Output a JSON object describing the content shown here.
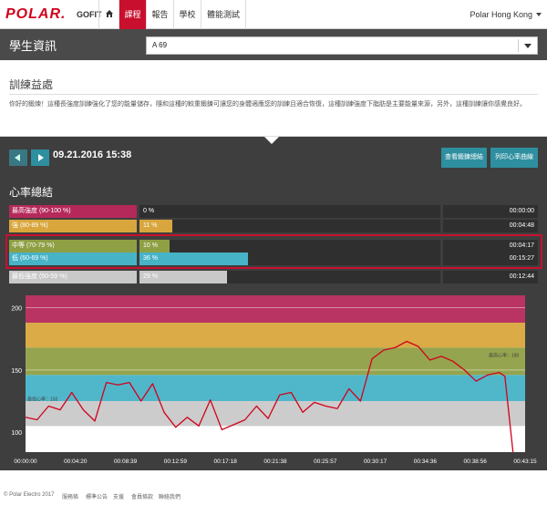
{
  "header": {
    "logo": "POLAR.",
    "product": "GOFIT",
    "nav": [
      "課程",
      "報告",
      "學校",
      "體能測試"
    ],
    "active_nav": "課程",
    "user": "Polar Hong Kong"
  },
  "student": {
    "label": "學生資訊",
    "selected": "A 69"
  },
  "benefit": {
    "title": "訓練益處",
    "text": "你好的鍛煉！這種長強度訓練強化了您的能量儲存，隨和這種的較重鍛鍊可讓您的身體適應您的訓練且適合恢復，這種訓練強度下脂肪是主要能量來源，另外，這種訓練讓你感覺良好。"
  },
  "session": {
    "date": "09.21.2016 15:38",
    "btn_detail": "查看鍛鍊總結",
    "btn_hr": "列印心率曲線",
    "hr_title": "心率總結"
  },
  "zones": [
    {
      "name": "最高強度 (90-100 %)",
      "pct_label": "0 %",
      "pct": 0,
      "time": "00:00:00",
      "color": "#b5295a",
      "name_bg": "#b5295a"
    },
    {
      "name": "強 (80-89 %)",
      "pct_label": "11 %",
      "pct": 11,
      "time": "00:04:48",
      "color": "#d8a63c",
      "name_bg": "#d8a63c"
    },
    {
      "name": "中等 (70-79 %)",
      "pct_label": "10 %",
      "pct": 10,
      "time": "00:04:17",
      "color": "#8f9f44",
      "name_bg": "#8f9f44"
    },
    {
      "name": "低 (60-69 %)",
      "pct_label": "36 %",
      "pct": 36,
      "time": "00:15:27",
      "color": "#47b3c7",
      "name_bg": "#47b3c7"
    },
    {
      "name": "最低強度 (50-59 %)",
      "pct_label": "29 %",
      "pct": 29,
      "time": "00:12:44",
      "color": "#c9c9c9",
      "name_bg": "#c9c9c9"
    }
  ],
  "chart_data": {
    "type": "line",
    "ylim": [
      0,
      210
    ],
    "yticks": [
      0,
      100,
      150,
      200
    ],
    "xticks": [
      "00:00:00",
      "00:04:20",
      "00:08:39",
      "00:12:59",
      "00:17:18",
      "00:21:38",
      "00:25:57",
      "00:30:17",
      "00:34:36",
      "00:38:56",
      "00:43:15"
    ],
    "zone_bands": [
      {
        "from": 188,
        "to": 210,
        "color": "#b5295a"
      },
      {
        "from": 168,
        "to": 188,
        "color": "#d8a63c"
      },
      {
        "from": 146,
        "to": 168,
        "color": "#8f9f44"
      },
      {
        "from": 125,
        "to": 146,
        "color": "#47b3c7"
      },
      {
        "from": 105,
        "to": 125,
        "color": "#c9c9c9"
      }
    ],
    "annotations": [
      {
        "label": "最低心率：103",
        "value": 127
      },
      {
        "label": "最高心率：180",
        "value": 162
      }
    ],
    "x_minutes": [
      0,
      1,
      2,
      3,
      4,
      5,
      6,
      7,
      8,
      9,
      10,
      11,
      12,
      13,
      14,
      15,
      16,
      17,
      18,
      19,
      20,
      21,
      22,
      23,
      24,
      25,
      26,
      27,
      28,
      29,
      30,
      31,
      32,
      33,
      34,
      35,
      36,
      37,
      38,
      39,
      40,
      41,
      41.5,
      42.2
    ],
    "heart_rate": [
      112,
      110,
      121,
      118,
      132,
      118,
      109,
      140,
      138,
      140,
      125,
      139,
      116,
      104,
      112,
      105,
      126,
      102,
      106,
      110,
      121,
      111,
      130,
      132,
      116,
      124,
      121,
      119,
      135,
      125,
      159,
      166,
      168,
      173,
      169,
      158,
      161,
      157,
      150,
      141,
      146,
      148,
      145,
      5
    ]
  },
  "footer": {
    "copyright": "© Polar Electro 2017",
    "links": [
      "服務條",
      "標準公告",
      "支援",
      "會員條款",
      "聯絡我們"
    ]
  }
}
